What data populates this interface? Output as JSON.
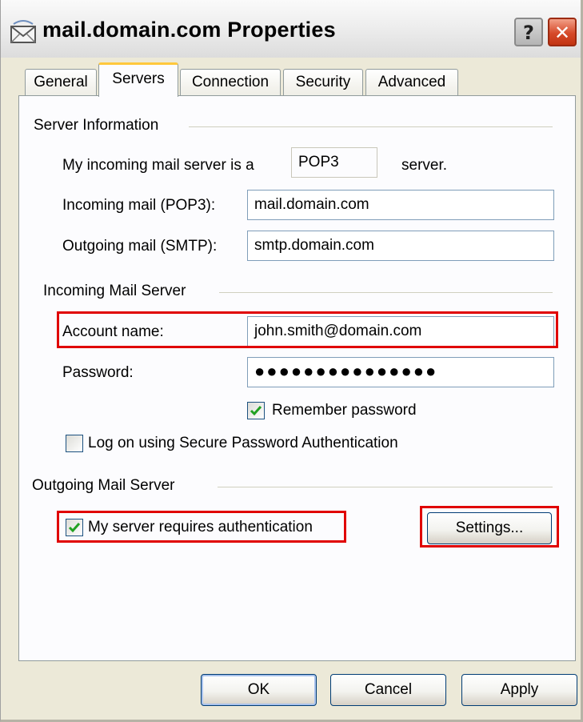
{
  "window": {
    "title": "mail.domain.com Properties",
    "help_glyph": "?",
    "close_glyph": "✕",
    "icon": "mail-envelope-icon"
  },
  "tabs": [
    {
      "label": "General",
      "active": false
    },
    {
      "label": "Servers",
      "active": true
    },
    {
      "label": "Connection",
      "active": false
    },
    {
      "label": "Security",
      "active": false
    },
    {
      "label": "Advanced",
      "active": false
    }
  ],
  "server_info": {
    "group_label": "Server Information",
    "incoming_type_prefix": "My incoming mail server is a",
    "incoming_type_value": "POP3",
    "incoming_type_suffix": "server.",
    "incoming_label": "Incoming mail (POP3):",
    "incoming_value": "mail.domain.com",
    "outgoing_label": "Outgoing mail (SMTP):",
    "outgoing_value": "smtp.domain.com"
  },
  "incoming_server": {
    "group_label": "Incoming Mail Server",
    "account_label": "Account name:",
    "account_value": "john.smith@domain.com",
    "password_label": "Password:",
    "password_value": "●●●●●●●●●●●●●●●",
    "remember_label": "Remember password",
    "remember_checked": true,
    "spa_label": "Log on using Secure Password Authentication",
    "spa_checked": false
  },
  "outgoing_server": {
    "group_label": "Outgoing Mail Server",
    "auth_label": "My server requires authentication",
    "auth_checked": true,
    "settings_label": "Settings..."
  },
  "buttons": {
    "ok": "OK",
    "cancel": "Cancel",
    "apply": "Apply"
  },
  "colors": {
    "highlight": "#e00000",
    "active_tab_accent": "#ffc83c",
    "checkmark": "#21a121"
  }
}
